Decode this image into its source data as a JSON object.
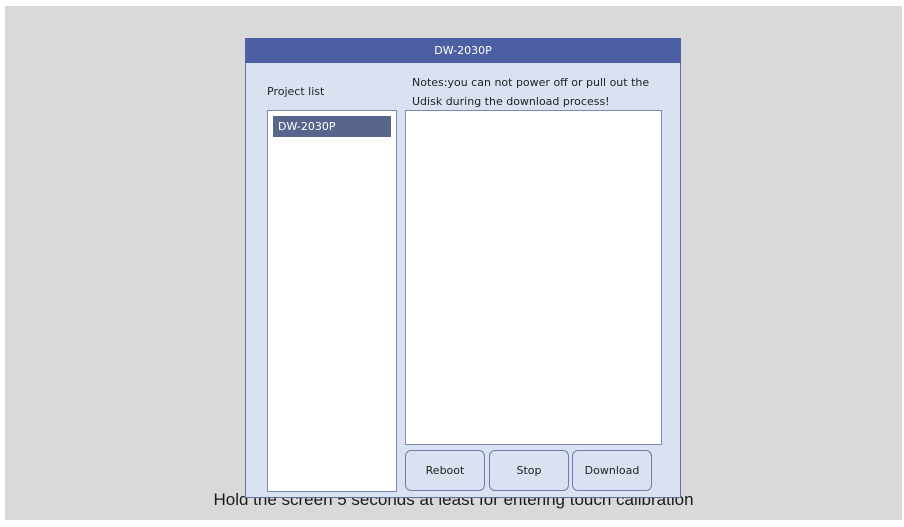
{
  "window": {
    "title": "DW-2030P"
  },
  "project_list": {
    "label": "Project list",
    "items": [
      {
        "label": "DW-2030P",
        "selected": true
      }
    ]
  },
  "notes": {
    "line1": "Notes:you can not power off or pull out the",
    "line2": "Udisk during the download process!"
  },
  "log": {
    "content": ""
  },
  "buttons": {
    "reboot": "Reboot",
    "stop": "Stop",
    "download": "Download"
  },
  "footer": {
    "calibration_hint": "Hold the screen 5 seconds at least for entering touch calibration"
  },
  "colors": {
    "title_bar": "#4d5fa3",
    "window_bg": "#dae2f1",
    "selected_item": "#58668e",
    "screen_bg": "#d9d9d9"
  }
}
